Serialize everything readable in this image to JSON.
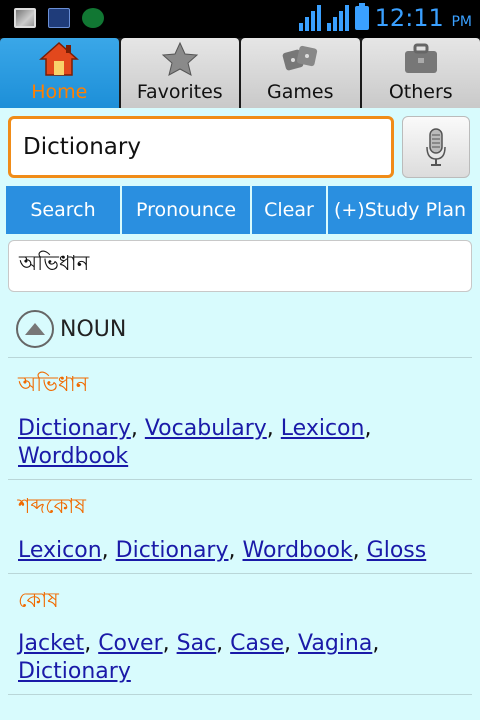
{
  "status_bar": {
    "time": "12:11",
    "ampm": "PM"
  },
  "tabs": [
    {
      "label": "Home",
      "icon": "home-icon",
      "active": true
    },
    {
      "label": "Favorites",
      "icon": "star-icon",
      "active": false
    },
    {
      "label": "Games",
      "icon": "dice-icon",
      "active": false
    },
    {
      "label": "Others",
      "icon": "briefcase-icon",
      "active": false
    }
  ],
  "search": {
    "value": "Dictionary"
  },
  "actions": {
    "search": "Search",
    "pronounce": "Pronounce",
    "clear": "Clear",
    "study_plan": "(+)Study Plan"
  },
  "result": {
    "translation": "অভিধান"
  },
  "pos": {
    "label": "NOUN"
  },
  "entries": [
    {
      "term": "অভিধান",
      "synonyms": [
        "Dictionary",
        "Vocabulary",
        "Lexicon",
        "Wordbook"
      ]
    },
    {
      "term": "শব্দকোষ",
      "synonyms": [
        "Lexicon",
        "Dictionary",
        "Wordbook",
        "Gloss"
      ]
    },
    {
      "term": "কোষ",
      "synonyms": [
        "Jacket",
        "Cover",
        "Sac",
        "Case",
        "Vagina",
        "Dictionary"
      ]
    }
  ],
  "colors": {
    "accent_blue": "#2a8fe0",
    "active_orange": "#ff7f00",
    "term_orange": "#f06a00",
    "link": "#1a1aa8",
    "background": "#d8fbfd"
  }
}
